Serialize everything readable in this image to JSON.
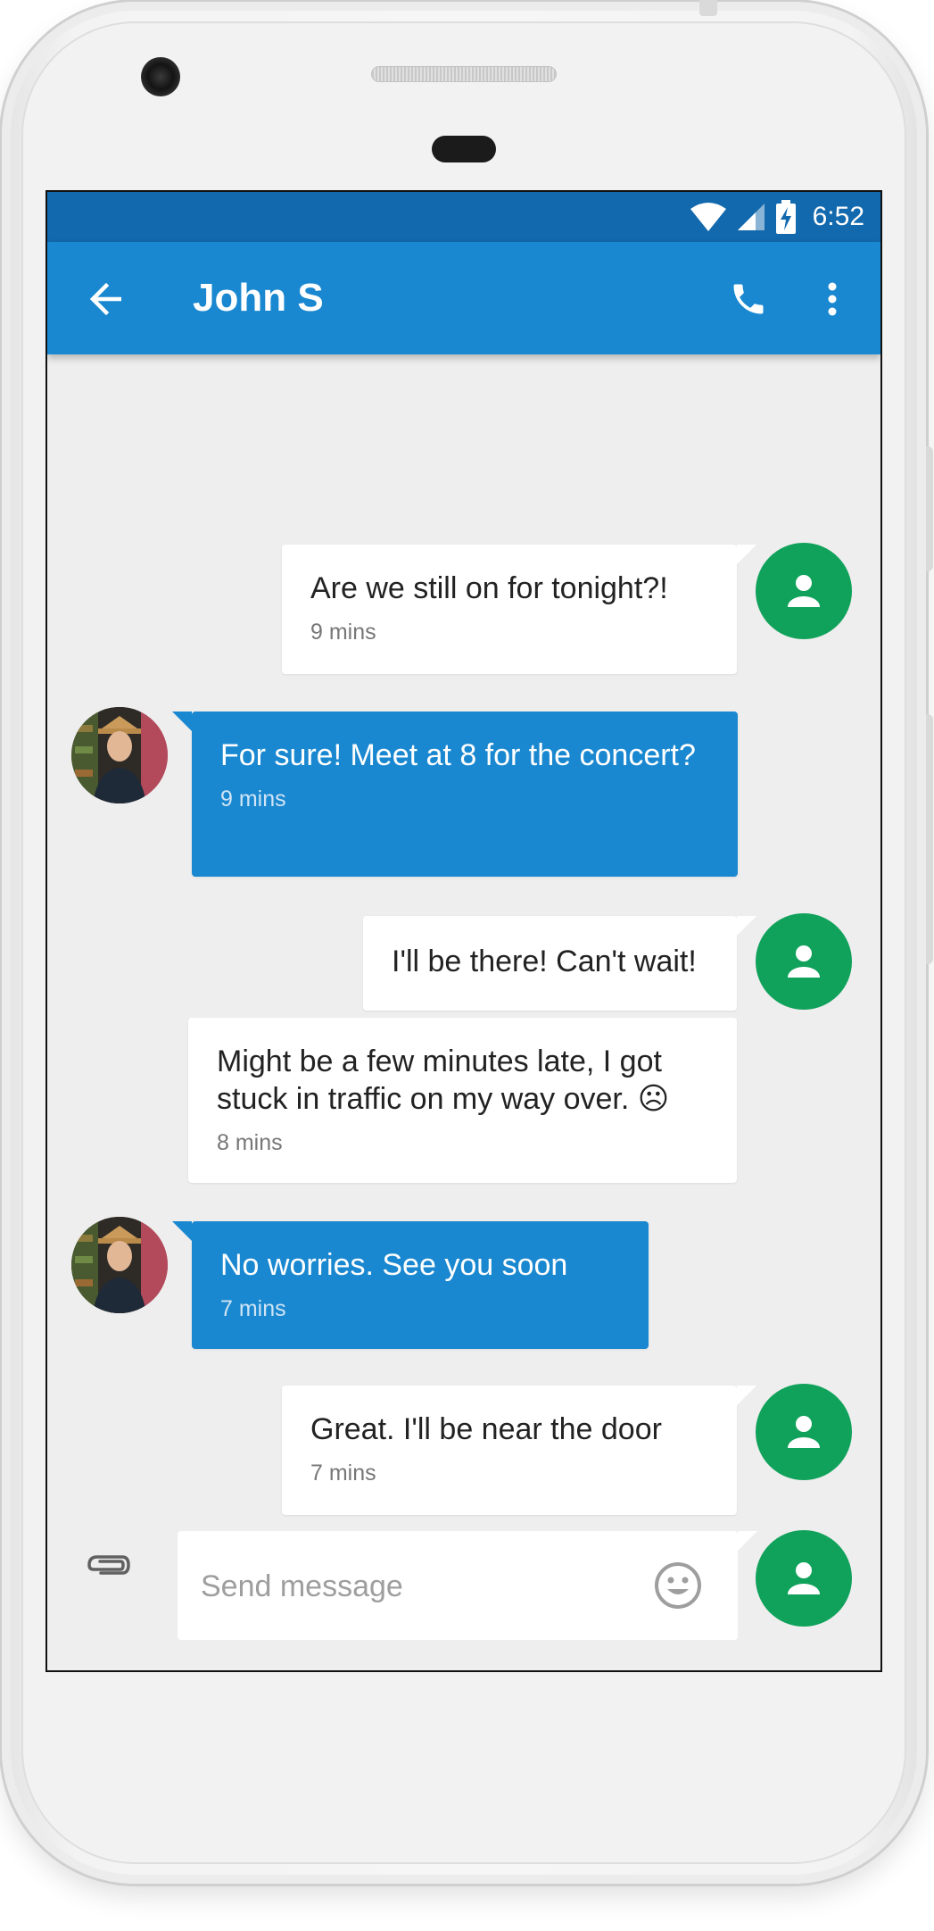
{
  "status_bar": {
    "time": "6:52",
    "icons": [
      "wifi-icon",
      "signal-icon",
      "battery-charging-icon"
    ]
  },
  "app_bar": {
    "title": "John S",
    "back_icon": "arrow-back-icon",
    "call_icon": "phone-icon",
    "more_icon": "more-vert-icon"
  },
  "messages": [
    {
      "from": "me",
      "text": "Are we still on for tonight?!",
      "time": "9 mins"
    },
    {
      "from": "john",
      "text": "For sure! Meet at 8 for the concert?",
      "time": "9 mins"
    },
    {
      "from": "me",
      "text": "I'll be there! Can't wait!",
      "time": ""
    },
    {
      "from": "me",
      "text": "Might be a few minutes late, I got stuck in traffic on my way over. ☹",
      "time": "8 mins"
    },
    {
      "from": "john",
      "text": "No worries. See you soon",
      "time": "7 mins"
    },
    {
      "from": "me",
      "text": "Great. I'll be near the door",
      "time": "7 mins"
    }
  ],
  "composer": {
    "placeholder": "Send message",
    "value": "",
    "attach_icon": "paperclip-icon",
    "emoji_icon": "smiley-icon"
  },
  "colors": {
    "status_bar": "#1369ad",
    "app_bar": "#1a88d0",
    "incoming_bubble": "#1a88d0",
    "outgoing_bubble": "#ffffff",
    "self_avatar": "#10a25b",
    "chat_background": "#eeeeee"
  }
}
